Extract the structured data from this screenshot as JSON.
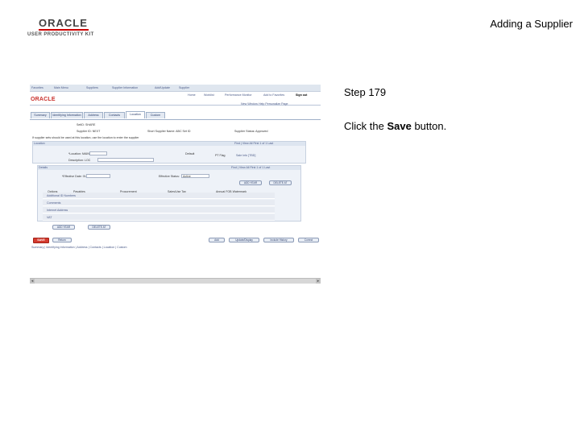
{
  "logo": {
    "brand": "ORACLE",
    "product": "USER PRODUCTIVITY KIT"
  },
  "slide": {
    "title": "Adding a Supplier",
    "step": "Step 179",
    "instruction_prefix": "Click the ",
    "instruction_bold": "Save",
    "instruction_suffix": " button."
  },
  "screenshot": {
    "nav_links": [
      "Favorites",
      "Main Menu",
      "Suppliers",
      "Supplier Information",
      "Add/Update",
      "Supplier"
    ],
    "header_links": [
      "Home",
      "Worklist",
      "Performance Monitor",
      "Add to Favorites",
      "Sign out"
    ],
    "brand": "ORACLE",
    "tabs": [
      "Summary",
      "Identifying Information",
      "Address",
      "Contacts",
      "Location",
      "Custom"
    ],
    "toolbar_links": "New Window  Help  Personalize Page",
    "setid": "SetID: SHARE",
    "supplier_id": "Supplier ID: NEXT",
    "short_name": "Short Supplier Name: ABC  Set ID",
    "status": "Supplier Status: Approved",
    "note": "If supplier sets should be used at this location, use the location to enter the supplier",
    "location_header": "Location",
    "find_nav": "Find | View All    First  1 of 1  Last",
    "location_label": "*Location: MAIN",
    "default_label": "Default",
    "pay_label": "PT Flag",
    "sale_label": "Sale Info [TBD]",
    "description": "Description: LOC",
    "details_header": "Details",
    "details_nav": "Find | View All    First  1 of 1  Last",
    "eff_date": "*Effective Date: 01/01/2013",
    "eff_status_label": "Effective Status:",
    "eff_status_value": "Active",
    "row_btn_1": "ADD YEAR",
    "row_btn_2": "DELETE AT",
    "col_headers": [
      "Options",
      "Payables",
      "Procurement",
      "Sales/Use Tax",
      "Annual FOB Watermark"
    ],
    "rows": [
      "Additional ID Numbers",
      "Comments",
      "Internet Address",
      "VAT"
    ],
    "bottom_btn_1": "ADD YEAR",
    "bottom_btn_2": "DELETE AT",
    "save_label": "SAVE",
    "return_label": "Return",
    "right_buttons": [
      "Add",
      "Update/Display",
      "Include History",
      "Correct"
    ],
    "footer_links": "Summary | Identifying Information | Address | Contacts | Location | Custom"
  }
}
